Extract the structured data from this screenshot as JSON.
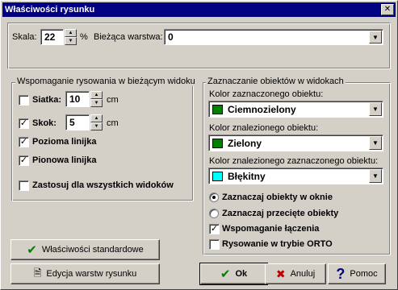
{
  "window": {
    "title": "Właściwości rysunku",
    "close_icon": "close-icon"
  },
  "top": {
    "scale_label": "Skala:",
    "scale_value": "22",
    "scale_unit": "%",
    "layer_label": "Bieżąca warstwa:",
    "layer_value": "0"
  },
  "drawing_aids": {
    "legend": "Wspomaganie rysowania w bieżącym widoku",
    "grid_label": "Siatka:",
    "grid_checked": false,
    "grid_value": "10",
    "grid_unit": "cm",
    "snap_label": "Skok:",
    "snap_checked": true,
    "snap_value": "5",
    "snap_unit": "cm",
    "hruler_label": "Pozioma linijka",
    "hruler_checked": true,
    "vruler_label": "Pionowa linijka",
    "vruler_checked": true,
    "apply_all_label": "Zastosuj dla wszystkich widoków",
    "apply_all_checked": false
  },
  "selection": {
    "legend": "Zaznaczanie obiektów w widokach",
    "selected_color_label": "Kolor zaznaczonego obiektu:",
    "selected_color_value": "Ciemnozielony",
    "selected_color_hex": "#008000",
    "found_color_label": "Kolor znalezionego obiektu:",
    "found_color_value": "Zielony",
    "found_color_hex": "#008000",
    "found_selected_color_label": "Kolor znalezionego zaznaczonego obiektu:",
    "found_selected_color_value": "Błękitny",
    "found_selected_color_hex": "#00ffff",
    "radio_window_label": "Zaznaczaj obiekty w oknie",
    "radio_window_checked": true,
    "radio_crossing_label": "Zaznaczaj przecięte obiekty",
    "radio_crossing_checked": false,
    "join_assist_label": "Wspomaganie łączenia",
    "join_assist_checked": true,
    "ortho_label": "Rysowanie w trybie ORTO",
    "ortho_checked": false
  },
  "buttons": {
    "defaults": "Właściwości standardowe",
    "layers": "Edycja warstw rysunku",
    "ok": "Ok",
    "cancel": "Anuluj",
    "help": "Pomoc"
  }
}
